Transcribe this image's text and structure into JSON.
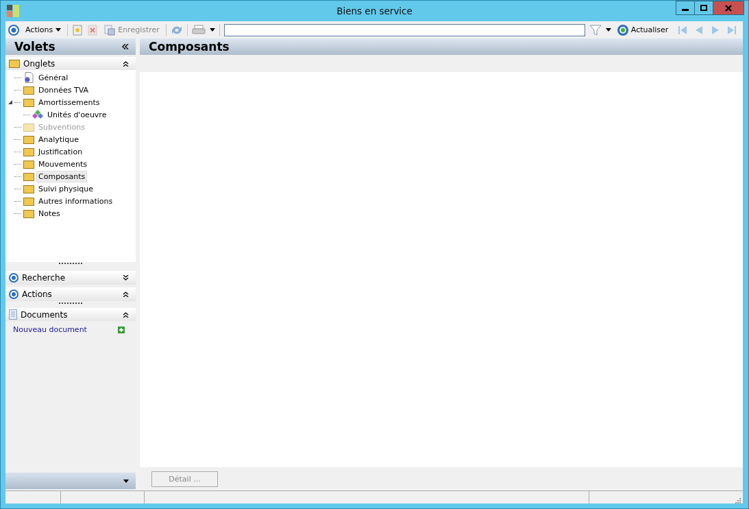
{
  "window": {
    "title": "Biens en service"
  },
  "toolbar": {
    "actions_label": "Actions",
    "save_label": "Enregistrer",
    "save_disabled": true,
    "refresh_label": "Actualiser",
    "nav_disabled": true
  },
  "sidebar": {
    "title": "Volets",
    "tabs_panel": {
      "title": "Onglets",
      "expanded": true,
      "items": [
        {
          "label": "Général",
          "kind": "doc",
          "disabled": false,
          "selected": false
        },
        {
          "label": "Données TVA",
          "kind": "folder",
          "disabled": false,
          "selected": false
        },
        {
          "label": "Amortissements",
          "kind": "folder",
          "disabled": false,
          "selected": false,
          "expanded": true,
          "children": [
            {
              "label": "Unités d'oeuvre",
              "kind": "diamond",
              "disabled": false,
              "selected": false
            }
          ]
        },
        {
          "label": "Subventions",
          "kind": "folder",
          "disabled": true,
          "selected": false
        },
        {
          "label": "Analytique",
          "kind": "folder",
          "disabled": false,
          "selected": false
        },
        {
          "label": "Justification",
          "kind": "folder",
          "disabled": false,
          "selected": false
        },
        {
          "label": "Mouvements",
          "kind": "folder",
          "disabled": false,
          "selected": false
        },
        {
          "label": "Composants",
          "kind": "folder",
          "disabled": false,
          "selected": true
        },
        {
          "label": "Suivi physique",
          "kind": "folder",
          "disabled": false,
          "selected": false
        },
        {
          "label": "Autres informations",
          "kind": "folder",
          "disabled": false,
          "selected": false
        },
        {
          "label": "Notes",
          "kind": "folder",
          "disabled": false,
          "selected": false
        }
      ]
    },
    "panels": [
      {
        "title": "Recherche",
        "expanded": false
      },
      {
        "title": "Actions",
        "expanded": true
      }
    ],
    "documents": {
      "title": "Documents",
      "expanded": true,
      "link": "Nouveau document"
    }
  },
  "main": {
    "title": "Composants",
    "detail_button": {
      "label": "Détail ...",
      "disabled": true
    }
  }
}
